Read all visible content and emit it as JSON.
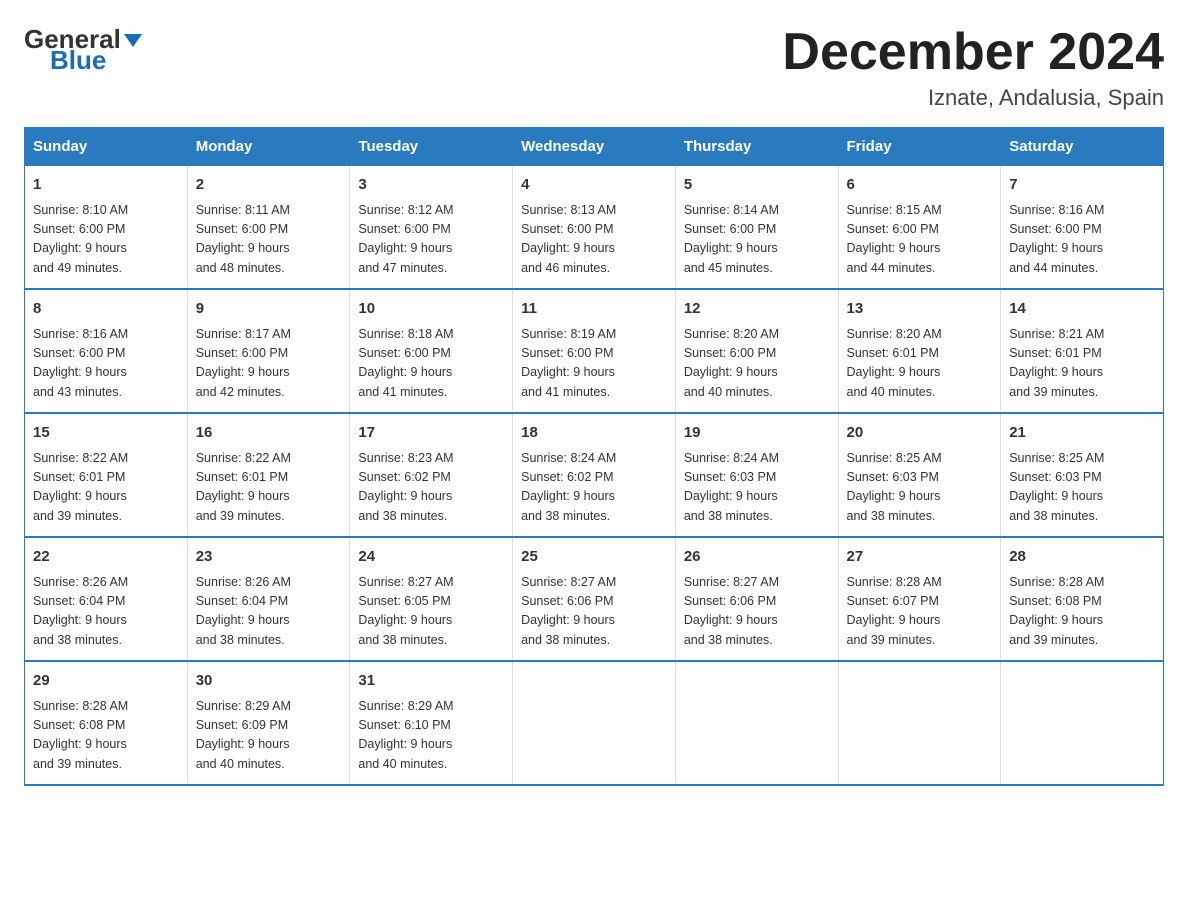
{
  "logo": {
    "general": "General",
    "blue": "Blue",
    "triangle": "▾"
  },
  "header": {
    "month": "December 2024",
    "location": "Iznate, Andalusia, Spain"
  },
  "days": [
    "Sunday",
    "Monday",
    "Tuesday",
    "Wednesday",
    "Thursday",
    "Friday",
    "Saturday"
  ],
  "weeks": [
    [
      {
        "num": "1",
        "sunrise": "8:10 AM",
        "sunset": "6:00 PM",
        "daylight": "9 hours and 49 minutes."
      },
      {
        "num": "2",
        "sunrise": "8:11 AM",
        "sunset": "6:00 PM",
        "daylight": "9 hours and 48 minutes."
      },
      {
        "num": "3",
        "sunrise": "8:12 AM",
        "sunset": "6:00 PM",
        "daylight": "9 hours and 47 minutes."
      },
      {
        "num": "4",
        "sunrise": "8:13 AM",
        "sunset": "6:00 PM",
        "daylight": "9 hours and 46 minutes."
      },
      {
        "num": "5",
        "sunrise": "8:14 AM",
        "sunset": "6:00 PM",
        "daylight": "9 hours and 45 minutes."
      },
      {
        "num": "6",
        "sunrise": "8:15 AM",
        "sunset": "6:00 PM",
        "daylight": "9 hours and 44 minutes."
      },
      {
        "num": "7",
        "sunrise": "8:16 AM",
        "sunset": "6:00 PM",
        "daylight": "9 hours and 44 minutes."
      }
    ],
    [
      {
        "num": "8",
        "sunrise": "8:16 AM",
        "sunset": "6:00 PM",
        "daylight": "9 hours and 43 minutes."
      },
      {
        "num": "9",
        "sunrise": "8:17 AM",
        "sunset": "6:00 PM",
        "daylight": "9 hours and 42 minutes."
      },
      {
        "num": "10",
        "sunrise": "8:18 AM",
        "sunset": "6:00 PM",
        "daylight": "9 hours and 41 minutes."
      },
      {
        "num": "11",
        "sunrise": "8:19 AM",
        "sunset": "6:00 PM",
        "daylight": "9 hours and 41 minutes."
      },
      {
        "num": "12",
        "sunrise": "8:20 AM",
        "sunset": "6:00 PM",
        "daylight": "9 hours and 40 minutes."
      },
      {
        "num": "13",
        "sunrise": "8:20 AM",
        "sunset": "6:01 PM",
        "daylight": "9 hours and 40 minutes."
      },
      {
        "num": "14",
        "sunrise": "8:21 AM",
        "sunset": "6:01 PM",
        "daylight": "9 hours and 39 minutes."
      }
    ],
    [
      {
        "num": "15",
        "sunrise": "8:22 AM",
        "sunset": "6:01 PM",
        "daylight": "9 hours and 39 minutes."
      },
      {
        "num": "16",
        "sunrise": "8:22 AM",
        "sunset": "6:01 PM",
        "daylight": "9 hours and 39 minutes."
      },
      {
        "num": "17",
        "sunrise": "8:23 AM",
        "sunset": "6:02 PM",
        "daylight": "9 hours and 38 minutes."
      },
      {
        "num": "18",
        "sunrise": "8:24 AM",
        "sunset": "6:02 PM",
        "daylight": "9 hours and 38 minutes."
      },
      {
        "num": "19",
        "sunrise": "8:24 AM",
        "sunset": "6:03 PM",
        "daylight": "9 hours and 38 minutes."
      },
      {
        "num": "20",
        "sunrise": "8:25 AM",
        "sunset": "6:03 PM",
        "daylight": "9 hours and 38 minutes."
      },
      {
        "num": "21",
        "sunrise": "8:25 AM",
        "sunset": "6:03 PM",
        "daylight": "9 hours and 38 minutes."
      }
    ],
    [
      {
        "num": "22",
        "sunrise": "8:26 AM",
        "sunset": "6:04 PM",
        "daylight": "9 hours and 38 minutes."
      },
      {
        "num": "23",
        "sunrise": "8:26 AM",
        "sunset": "6:04 PM",
        "daylight": "9 hours and 38 minutes."
      },
      {
        "num": "24",
        "sunrise": "8:27 AM",
        "sunset": "6:05 PM",
        "daylight": "9 hours and 38 minutes."
      },
      {
        "num": "25",
        "sunrise": "8:27 AM",
        "sunset": "6:06 PM",
        "daylight": "9 hours and 38 minutes."
      },
      {
        "num": "26",
        "sunrise": "8:27 AM",
        "sunset": "6:06 PM",
        "daylight": "9 hours and 38 minutes."
      },
      {
        "num": "27",
        "sunrise": "8:28 AM",
        "sunset": "6:07 PM",
        "daylight": "9 hours and 39 minutes."
      },
      {
        "num": "28",
        "sunrise": "8:28 AM",
        "sunset": "6:08 PM",
        "daylight": "9 hours and 39 minutes."
      }
    ],
    [
      {
        "num": "29",
        "sunrise": "8:28 AM",
        "sunset": "6:08 PM",
        "daylight": "9 hours and 39 minutes."
      },
      {
        "num": "30",
        "sunrise": "8:29 AM",
        "sunset": "6:09 PM",
        "daylight": "9 hours and 40 minutes."
      },
      {
        "num": "31",
        "sunrise": "8:29 AM",
        "sunset": "6:10 PM",
        "daylight": "9 hours and 40 minutes."
      },
      null,
      null,
      null,
      null
    ]
  ],
  "labels": {
    "sunrise": "Sunrise:",
    "sunset": "Sunset:",
    "daylight": "Daylight:"
  }
}
